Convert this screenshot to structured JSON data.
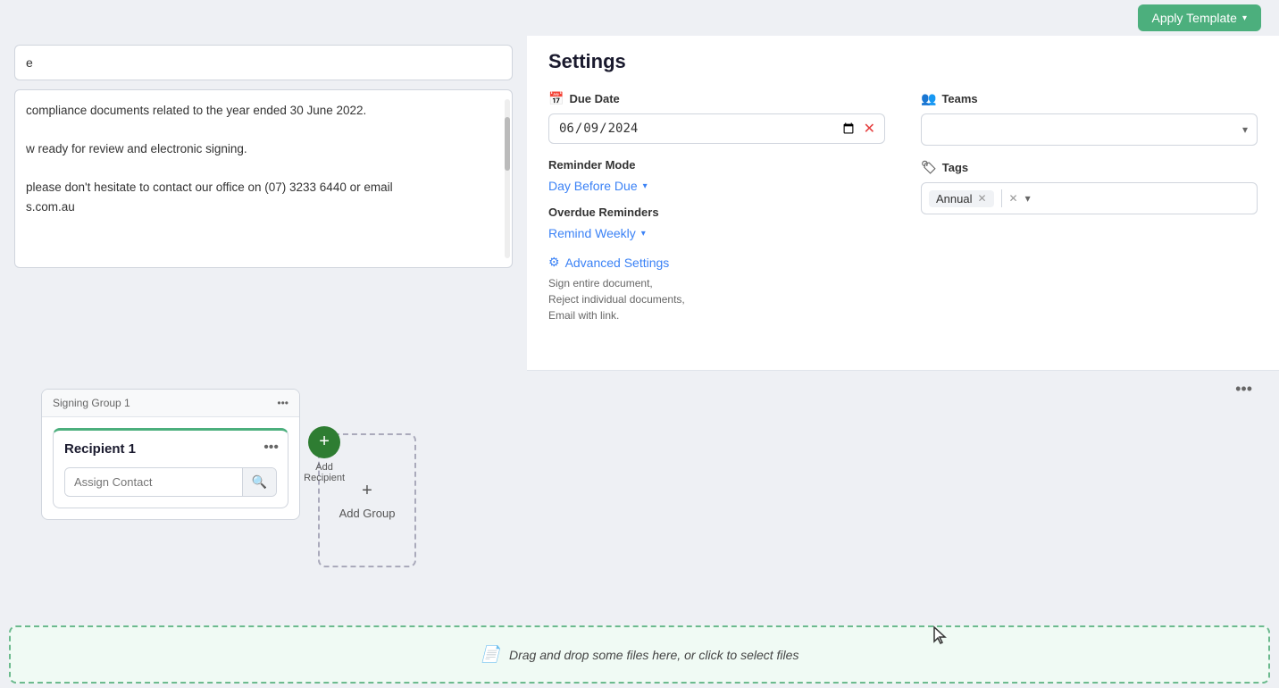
{
  "applyTemplate": {
    "label": "Apply Template",
    "chevron": "▾"
  },
  "textContent": {
    "inputPlaceholder": "e",
    "bodyText1": "compliance documents related to the year ended 30 June 2022.",
    "bodyText2": "w ready for review and electronic signing.",
    "bodyText3": "please don't hesitate to contact our office on (07) 3233 6440 or email",
    "bodyText4": "s.com.au"
  },
  "settings": {
    "title": "Settings",
    "dueDate": {
      "label": "Due Date",
      "value": "06/09/2024",
      "icon": "📅"
    },
    "teams": {
      "label": "Teams"
    },
    "reminderMode": {
      "label": "Reminder Mode",
      "value": "Day Before Due",
      "chevron": "▾"
    },
    "overdueReminders": {
      "label": "Overdue Reminders",
      "value": "Remind Weekly",
      "chevron": "▾"
    },
    "tags": {
      "label": "Tags",
      "icon": "🏷",
      "chips": [
        {
          "label": "Annual"
        }
      ]
    },
    "advancedSettings": {
      "label": "Advanced Settings",
      "icon": "⚙",
      "description": "Sign entire document,\nReject individual documents,\nEmail with link."
    }
  },
  "signingSection": {
    "threeDot": "•••",
    "group": {
      "title": "Signing Group 1",
      "threeDot": "•••",
      "recipient": {
        "title": "Recipient 1",
        "assignContactPlaceholder": "Assign Contact",
        "threeDot": "•••"
      },
      "addRecipient": {
        "icon": "+",
        "label": "Add\nRecipient"
      }
    },
    "addGroup": {
      "icon": "+",
      "label": "Add Group"
    }
  },
  "fileDropArea": {
    "icon": "📄",
    "text": "Drag and drop some files here, or click to select files"
  }
}
